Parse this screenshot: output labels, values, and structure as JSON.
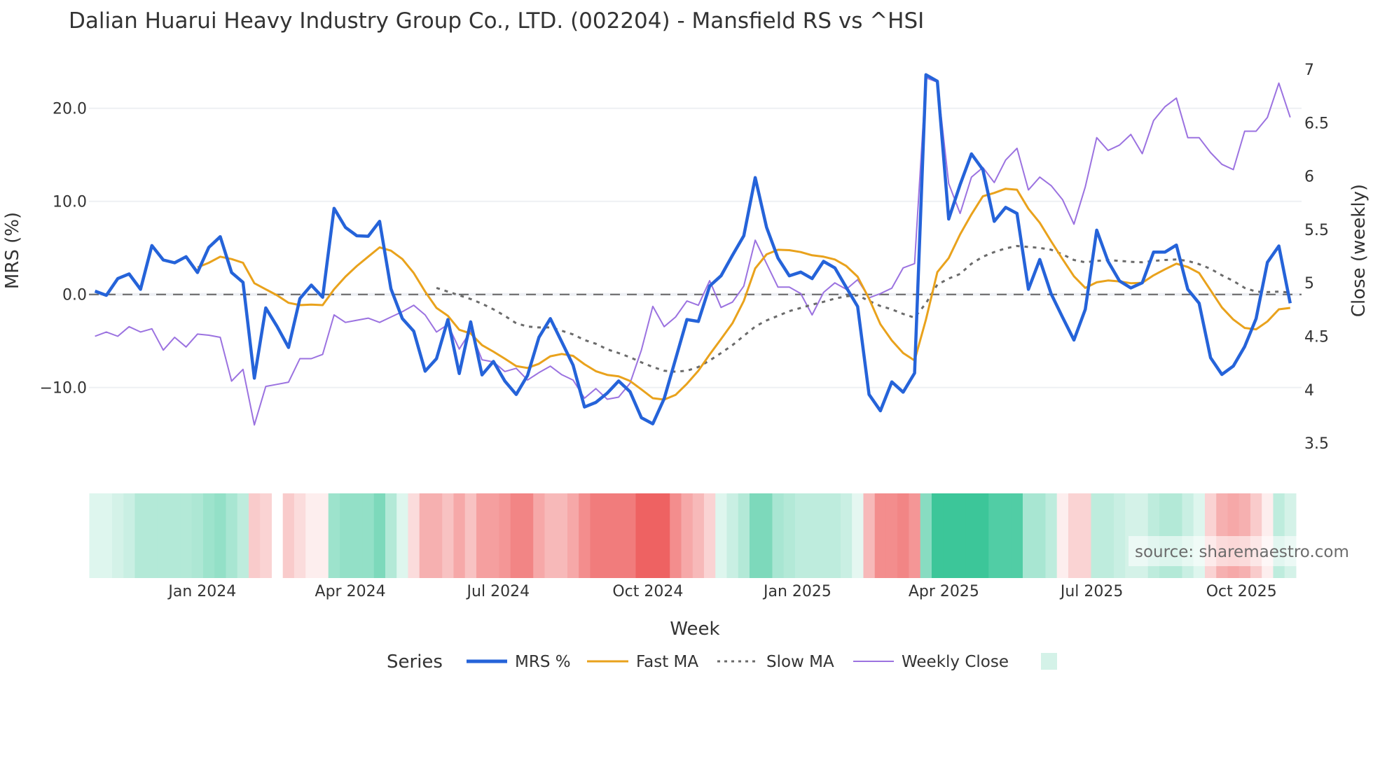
{
  "chart_data": {
    "type": "line",
    "title": "Dalian Huarui Heavy Industry Group Co., LTD. (002204) - Mansfield RS vs ^HSI",
    "xlabel": "Week",
    "ylabel": "MRS (%)",
    "y2label": "Close (weekly)",
    "start_week": "2023-10-27",
    "x_ticks": [
      {
        "label": "Jan 2024",
        "date": "2024-01-01"
      },
      {
        "label": "Apr 2024",
        "date": "2024-04-01"
      },
      {
        "label": "Jul 2024",
        "date": "2024-07-01"
      },
      {
        "label": "Oct 2024",
        "date": "2024-10-01"
      },
      {
        "label": "Jan 2025",
        "date": "2025-01-01"
      },
      {
        "label": "Apr 2025",
        "date": "2025-04-01"
      },
      {
        "label": "Jul 2025",
        "date": "2025-07-01"
      },
      {
        "label": "Oct 2025",
        "date": "2025-10-01"
      }
    ],
    "y_ticks": [
      {
        "v": 20,
        "label": "20.0"
      },
      {
        "v": 10,
        "label": "10.0"
      },
      {
        "v": 0,
        "label": "0.0"
      },
      {
        "v": -10,
        "label": "−10.0"
      }
    ],
    "y2_ticks": [
      {
        "v": 7,
        "label": "7"
      },
      {
        "v": 6.5,
        "label": "6.5"
      },
      {
        "v": 6,
        "label": "6"
      },
      {
        "v": 5.5,
        "label": "5.5"
      },
      {
        "v": 5,
        "label": "5"
      },
      {
        "v": 4.5,
        "label": "4.5"
      },
      {
        "v": 4,
        "label": "4"
      },
      {
        "v": 3.5,
        "label": "3.5"
      }
    ],
    "ylim": [
      -17.6,
      26
    ],
    "y2lim": [
      3.2,
      7.2
    ],
    "grid": true,
    "legend": {
      "title": "Series",
      "placement": "bottom"
    },
    "series": [
      {
        "name": "MRS %",
        "axis": "y",
        "color": "#2563d9",
        "style": "solid",
        "values": [
          0.35,
          -0.1,
          1.7,
          2.2,
          0.55,
          5.25,
          3.7,
          3.4,
          4.05,
          2.35,
          5.05,
          6.2,
          2.35,
          1.3,
          -9.0,
          -1.45,
          -3.45,
          -5.7,
          -0.45,
          1.0,
          -0.3,
          9.25,
          7.2,
          6.3,
          6.25,
          7.85,
          0.6,
          -2.6,
          -3.95,
          -8.25,
          -6.9,
          -2.7,
          -8.5,
          -2.95,
          -8.65,
          -7.2,
          -9.3,
          -10.75,
          -8.7,
          -4.6,
          -2.6,
          -5.1,
          -7.6,
          -12.1,
          -11.6,
          -10.6,
          -9.3,
          -10.45,
          -13.25,
          -13.9,
          -11.2,
          -6.95,
          -2.7,
          -2.9,
          0.9,
          2.0,
          4.2,
          6.3,
          12.55,
          7.2,
          3.9,
          2.0,
          2.4,
          1.7,
          3.55,
          2.85,
          0.75,
          -1.3,
          -10.75,
          -12.5,
          -9.4,
          -10.5,
          -8.45,
          23.6,
          22.9,
          8.1,
          11.8,
          15.1,
          13.4,
          7.85,
          9.35,
          8.7,
          0.55,
          3.75,
          0.05,
          -2.45,
          -4.9,
          -1.6,
          6.9,
          3.55,
          1.45,
          0.7,
          1.25,
          4.55,
          4.55,
          5.3,
          0.55,
          -0.95,
          -6.8,
          -8.6,
          -7.7,
          -5.6,
          -2.6,
          3.45,
          5.2,
          -0.95
        ]
      },
      {
        "name": "Fast MA",
        "axis": "y",
        "color": "#e9a21c",
        "style": "solid",
        "values": [
          null,
          null,
          null,
          null,
          null,
          null,
          null,
          null,
          null,
          2.9,
          3.4,
          4.05,
          3.8,
          3.4,
          1.2,
          0.55,
          -0.1,
          -0.9,
          -1.15,
          -1.1,
          -1.15,
          0.55,
          1.9,
          3.05,
          4.05,
          5.05,
          4.7,
          3.8,
          2.3,
          0.3,
          -1.45,
          -2.3,
          -3.8,
          -4.2,
          -5.45,
          -6.15,
          -6.9,
          -7.7,
          -7.9,
          -7.45,
          -6.65,
          -6.4,
          -6.6,
          -7.5,
          -8.25,
          -8.65,
          -8.8,
          -9.3,
          -10.2,
          -11.15,
          -11.3,
          -10.8,
          -9.6,
          -8.2,
          -6.45,
          -4.8,
          -3.1,
          -0.7,
          2.8,
          4.3,
          4.8,
          4.75,
          4.55,
          4.2,
          4.05,
          3.75,
          3.05,
          1.9,
          -0.45,
          -3.2,
          -4.95,
          -6.3,
          -7.1,
          -2.7,
          2.4,
          3.9,
          6.45,
          8.6,
          10.55,
          10.9,
          11.35,
          11.25,
          9.2,
          7.7,
          5.7,
          3.8,
          1.95,
          0.7,
          1.3,
          1.5,
          1.4,
          1.2,
          1.25,
          2.05,
          2.7,
          3.3,
          2.95,
          2.3,
          0.45,
          -1.4,
          -2.7,
          -3.6,
          -3.75,
          -2.9,
          -1.6,
          -1.45
        ]
      },
      {
        "name": "Slow MA",
        "axis": "y",
        "color": "#6b6b6b",
        "style": "dotted",
        "values": [
          null,
          null,
          null,
          null,
          null,
          null,
          null,
          null,
          null,
          null,
          null,
          null,
          null,
          null,
          null,
          null,
          null,
          null,
          null,
          null,
          null,
          null,
          null,
          null,
          null,
          null,
          null,
          null,
          null,
          null,
          0.7,
          0.3,
          -0.1,
          -0.5,
          -1.0,
          -1.6,
          -2.3,
          -3.1,
          -3.45,
          -3.55,
          -3.55,
          -3.9,
          -4.3,
          -4.9,
          -5.3,
          -5.9,
          -6.3,
          -6.75,
          -7.3,
          -7.8,
          -8.2,
          -8.3,
          -8.2,
          -7.8,
          -7.1,
          -6.3,
          -5.45,
          -4.45,
          -3.45,
          -2.8,
          -2.3,
          -1.8,
          -1.45,
          -1.1,
          -0.8,
          -0.45,
          -0.2,
          -0.1,
          -0.7,
          -1.25,
          -1.6,
          -2.1,
          -2.5,
          -0.95,
          1.05,
          1.7,
          2.2,
          3.3,
          4.05,
          4.55,
          4.95,
          5.2,
          5.1,
          5.0,
          4.8,
          4.3,
          3.7,
          3.45,
          3.6,
          3.7,
          3.6,
          3.5,
          3.45,
          3.6,
          3.7,
          3.75,
          3.6,
          3.25,
          2.75,
          2.05,
          1.45,
          0.7,
          0.3,
          0.25,
          0.3,
          0.2
        ]
      },
      {
        "name": "Weekly Close",
        "axis": "y2",
        "color": "#9b72e0",
        "style": "solid",
        "values": [
          4.5,
          4.54,
          4.5,
          4.59,
          4.54,
          4.57,
          4.37,
          4.49,
          4.4,
          4.52,
          4.51,
          4.49,
          4.08,
          4.19,
          3.67,
          4.03,
          4.05,
          4.07,
          4.29,
          4.29,
          4.33,
          4.7,
          4.63,
          4.65,
          4.67,
          4.63,
          4.68,
          4.73,
          4.79,
          4.7,
          4.54,
          4.61,
          4.38,
          4.55,
          4.28,
          4.26,
          4.17,
          4.2,
          4.09,
          4.16,
          4.22,
          4.14,
          4.09,
          3.92,
          4.01,
          3.91,
          3.93,
          4.06,
          4.37,
          4.78,
          4.59,
          4.68,
          4.83,
          4.79,
          5.02,
          4.77,
          4.82,
          4.97,
          5.4,
          5.18,
          4.96,
          4.96,
          4.9,
          4.7,
          4.91,
          5.0,
          4.94,
          5.03,
          4.86,
          4.9,
          4.95,
          5.14,
          5.18,
          6.92,
          6.88,
          5.93,
          5.65,
          5.99,
          6.08,
          5.94,
          6.15,
          6.26,
          5.87,
          5.99,
          5.91,
          5.78,
          5.55,
          5.9,
          6.36,
          6.24,
          6.29,
          6.39,
          6.21,
          6.52,
          6.65,
          6.73,
          6.36,
          6.36,
          6.22,
          6.11,
          6.06,
          6.42,
          6.42,
          6.55,
          6.87,
          6.55
        ]
      }
    ],
    "heatmap": {
      "positive_color": "#26c08e",
      "negative_color": "#ec5050",
      "values": [
        0.15,
        0.15,
        0.2,
        0.25,
        0.35,
        0.35,
        0.35,
        0.35,
        0.35,
        0.38,
        0.45,
        0.5,
        0.4,
        0.3,
        -0.3,
        -0.25,
        null,
        -0.3,
        -0.2,
        -0.1,
        -0.1,
        0.45,
        0.5,
        0.5,
        0.5,
        0.6,
        0.35,
        0.15,
        -0.2,
        -0.45,
        -0.45,
        -0.35,
        -0.5,
        -0.35,
        -0.55,
        -0.55,
        -0.6,
        -0.7,
        -0.7,
        -0.5,
        -0.4,
        -0.4,
        -0.5,
        -0.65,
        -0.75,
        -0.75,
        -0.75,
        -0.75,
        -0.9,
        -0.9,
        -0.9,
        -0.65,
        -0.5,
        -0.4,
        -0.25,
        0.15,
        0.25,
        0.35,
        0.6,
        0.6,
        0.4,
        0.35,
        0.3,
        0.3,
        0.3,
        0.3,
        0.25,
        0.12,
        -0.4,
        -0.65,
        -0.65,
        -0.7,
        -0.6,
        0.55,
        0.9,
        0.9,
        0.9,
        0.9,
        0.9,
        0.8,
        0.8,
        0.8,
        0.4,
        0.4,
        0.3,
        -0.1,
        -0.25,
        -0.25,
        0.3,
        0.3,
        0.25,
        0.2,
        0.2,
        0.3,
        0.35,
        0.35,
        0.25,
        0.15,
        -0.25,
        -0.45,
        -0.5,
        -0.45,
        -0.3,
        -0.1,
        0.3,
        0.2
      ]
    },
    "zero_line": 0
  },
  "source": "source: sharemaestro.com"
}
